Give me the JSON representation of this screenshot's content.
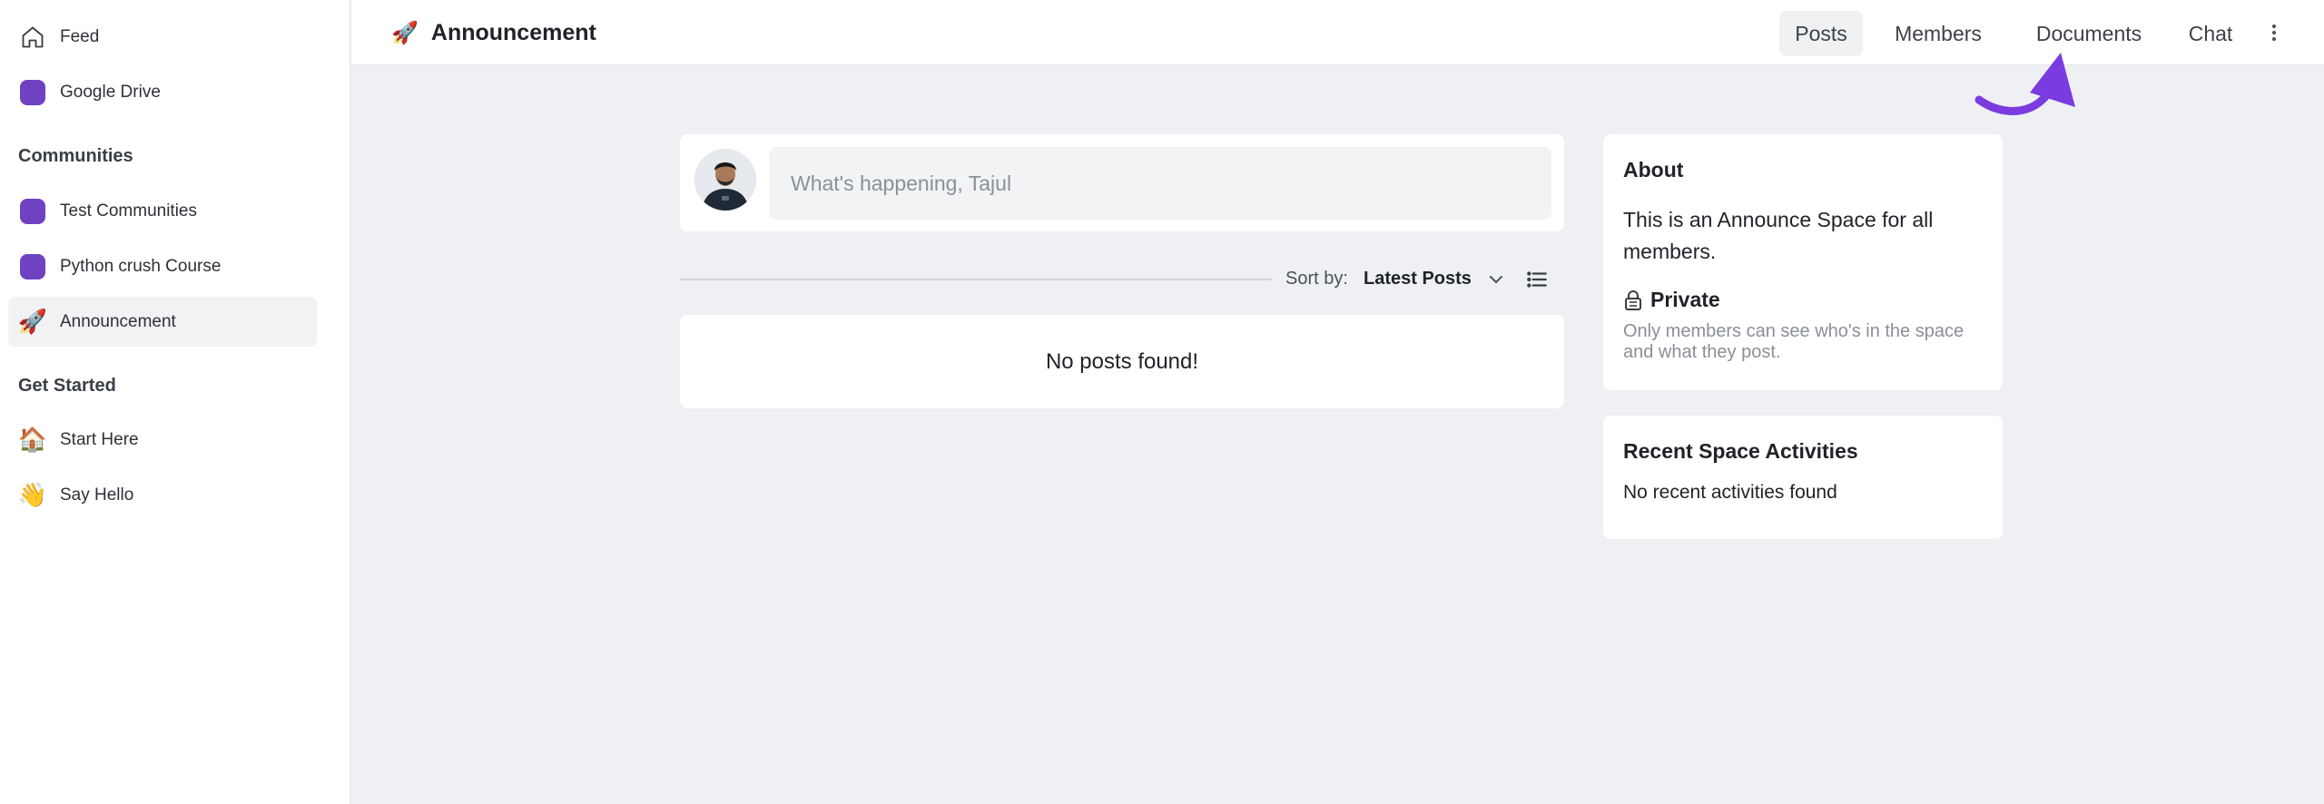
{
  "sidebar": {
    "top_items": [
      {
        "label": "Feed",
        "icon": "home-icon"
      },
      {
        "label": "Google Drive",
        "icon": "square-dot-icon"
      }
    ],
    "sections": [
      {
        "heading": "Communities",
        "items": [
          {
            "label": "Test Communities",
            "icon": "square-dot-icon"
          },
          {
            "label": "Python crush Course",
            "icon": "square-dot-icon"
          },
          {
            "label": "Announcement",
            "icon": "rocket-icon",
            "emoji": "🚀",
            "active": true
          }
        ]
      },
      {
        "heading": "Get Started",
        "items": [
          {
            "label": "Start Here",
            "icon": "house-icon",
            "emoji": "🏠"
          },
          {
            "label": "Say Hello",
            "icon": "wave-icon",
            "emoji": "👋"
          }
        ]
      }
    ]
  },
  "header": {
    "title_emoji": "🚀",
    "title": "Announcement",
    "nav": [
      {
        "label": "Posts",
        "active": true
      },
      {
        "label": "Members"
      },
      {
        "label": "Documents"
      },
      {
        "label": "Chat"
      }
    ]
  },
  "composer": {
    "placeholder": "What's happening, Tajul"
  },
  "sort": {
    "label": "Sort by:",
    "value": "Latest Posts"
  },
  "feed": {
    "empty_message": "No posts found!"
  },
  "about": {
    "title": "About",
    "description": "This is an Announce Space for all members.",
    "privacy_label": "Private",
    "privacy_description": "Only members can see who's in the space and what they post."
  },
  "activities": {
    "title": "Recent Space Activities",
    "empty_message": "No recent activities found"
  },
  "colors": {
    "accent": "#6f42c1",
    "arrow": "#7a3be0",
    "background": "#eef0f3"
  }
}
